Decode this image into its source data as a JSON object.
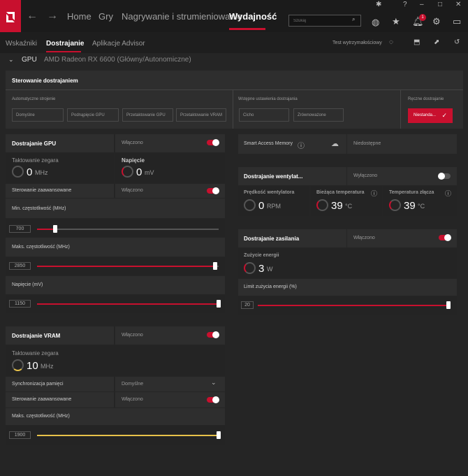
{
  "topbar": {
    "tabs": [
      "Home",
      "Gry",
      "Nagrywanie i strumieniowanie",
      "Wydajność"
    ],
    "search_placeholder": "Szukaj",
    "notification_count": "1",
    "accent": "#c8102e"
  },
  "subbar": {
    "tabs": [
      "Wskaźniki",
      "Dostrajanie",
      "Aplikacje Advisor"
    ],
    "stress_test": "Test wytrzymałościowy"
  },
  "gpu": {
    "label": "GPU",
    "name": "AMD Radeon RX 6600 (Główny/Autonomiczne)"
  },
  "tuning_control": {
    "title": "Sterowanie dostrajaniem",
    "auto_label": "Automatyczne strojenie",
    "auto_buttons": [
      "Domyślne",
      "Podnąpięcie GPU",
      "Przetaktowanie GPU",
      "Przetaktowanie VRAM"
    ],
    "preset_label": "Wstępne ustawienia dostrajania",
    "preset_buttons": [
      "Cicho",
      "Zrównoważone"
    ],
    "manual_label": "Ręczne dostrajanie",
    "manual_button": "Niestanda..."
  },
  "gpu_tuning": {
    "title": "Dostrajanie GPU",
    "state": "Włączono",
    "clock_label": "Taktowanie zegara",
    "clock_value": "0",
    "clock_unit": "MHz",
    "voltage_label": "Napięcie",
    "voltage_value": "0",
    "voltage_unit": "mV",
    "advanced_label": "Sterowanie zaawansowane",
    "advanced_state": "Włączono",
    "min_freq_label": "Min. częstotliwość (MHz)",
    "min_freq_value": "700",
    "min_freq_fraction": 0.1,
    "max_freq_label": "Maks. częstotliwość (MHz)",
    "max_freq_value": "2850",
    "max_freq_fraction": 0.98,
    "voltage_mv_label": "Napięcie (mV)",
    "voltage_mv_value": "1150",
    "voltage_mv_fraction": 1.0
  },
  "vram_tuning": {
    "title": "Dostrajanie VRAM",
    "state": "Włączono",
    "clock_label": "Taktowanie zegara",
    "clock_value": "10",
    "clock_unit": "MHz",
    "sync_label": "Synchronizacja pamięci",
    "sync_value": "Domyślne",
    "advanced_label": "Sterowanie zaawansowane",
    "advanced_state": "Włączono",
    "max_freq_label": "Maks. częstotliwość (MHz)",
    "max_freq_value": "1900",
    "max_freq_fraction": 1.0,
    "slider_color": "#e8c24a"
  },
  "sam": {
    "label": "Smart Access Memory",
    "value": "Niedostępne"
  },
  "fan_tuning": {
    "title": "Dostrajanie wentylat...",
    "state": "Wyłączono",
    "fan_speed_label": "Prędkość wentylatora",
    "fan_speed_value": "0",
    "fan_speed_unit": "RPM",
    "temp_label": "Bieżąca temperatura",
    "temp_value": "39",
    "temp_unit": "°C",
    "junction_label": "Temperatura złącza",
    "junction_value": "39",
    "junction_unit": "°C"
  },
  "power_tuning": {
    "title": "Dostrajanie zasilania",
    "state": "Włączono",
    "usage_label": "Zużycie energii",
    "usage_value": "3",
    "usage_unit": "W",
    "limit_label": "Limit zużycia energii (%)",
    "limit_value": "20",
    "limit_fraction": 1.0
  }
}
